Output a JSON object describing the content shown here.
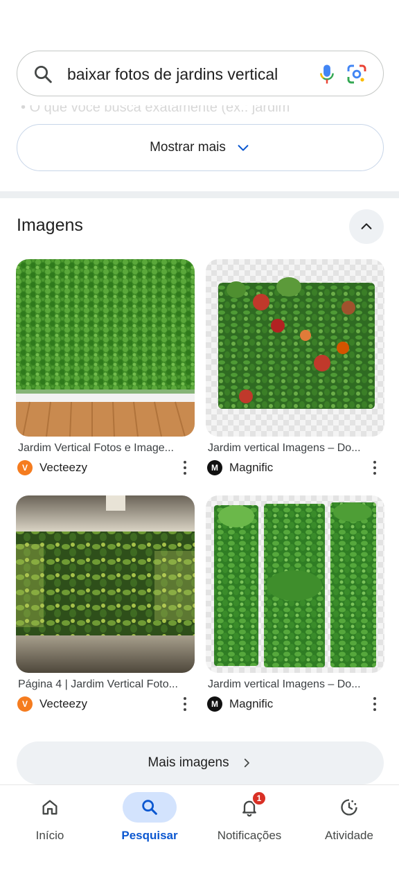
{
  "search": {
    "query": "baixar fotos de jardins vertical"
  },
  "faded_text": "O que você busca exatamente (ex.: jardim",
  "show_more": {
    "label": "Mostrar mais"
  },
  "images_section": {
    "title": "Imagens",
    "results": [
      {
        "caption": "Jardim Vertical Fotos e Image...",
        "source": "Vecteezy",
        "source_logo": "vecteezy-logo"
      },
      {
        "caption": "Jardim vertical Imagens – Do...",
        "source": "Magnific",
        "source_logo": "magnific-logo"
      },
      {
        "caption": "Página 4 | Jardim Vertical Foto...",
        "source": "Vecteezy",
        "source_logo": "vecteezy-logo"
      },
      {
        "caption": "Jardim vertical Imagens – Do...",
        "source": "Magnific",
        "source_logo": "magnific-logo"
      }
    ],
    "more_images_label": "Mais imagens"
  },
  "bottom_nav": {
    "items": [
      {
        "label": "Início",
        "icon": "home-icon"
      },
      {
        "label": "Pesquisar",
        "icon": "search-icon",
        "active": true
      },
      {
        "label": "Notificações",
        "icon": "bell-icon",
        "badge": "1"
      },
      {
        "label": "Atividade",
        "icon": "activity-icon"
      }
    ]
  },
  "colors": {
    "accent": "#0b57d0",
    "active_pill": "#d3e3fd",
    "badge": "#d93025",
    "vecteezy": "#f57c1f",
    "magnific": "#111111"
  }
}
